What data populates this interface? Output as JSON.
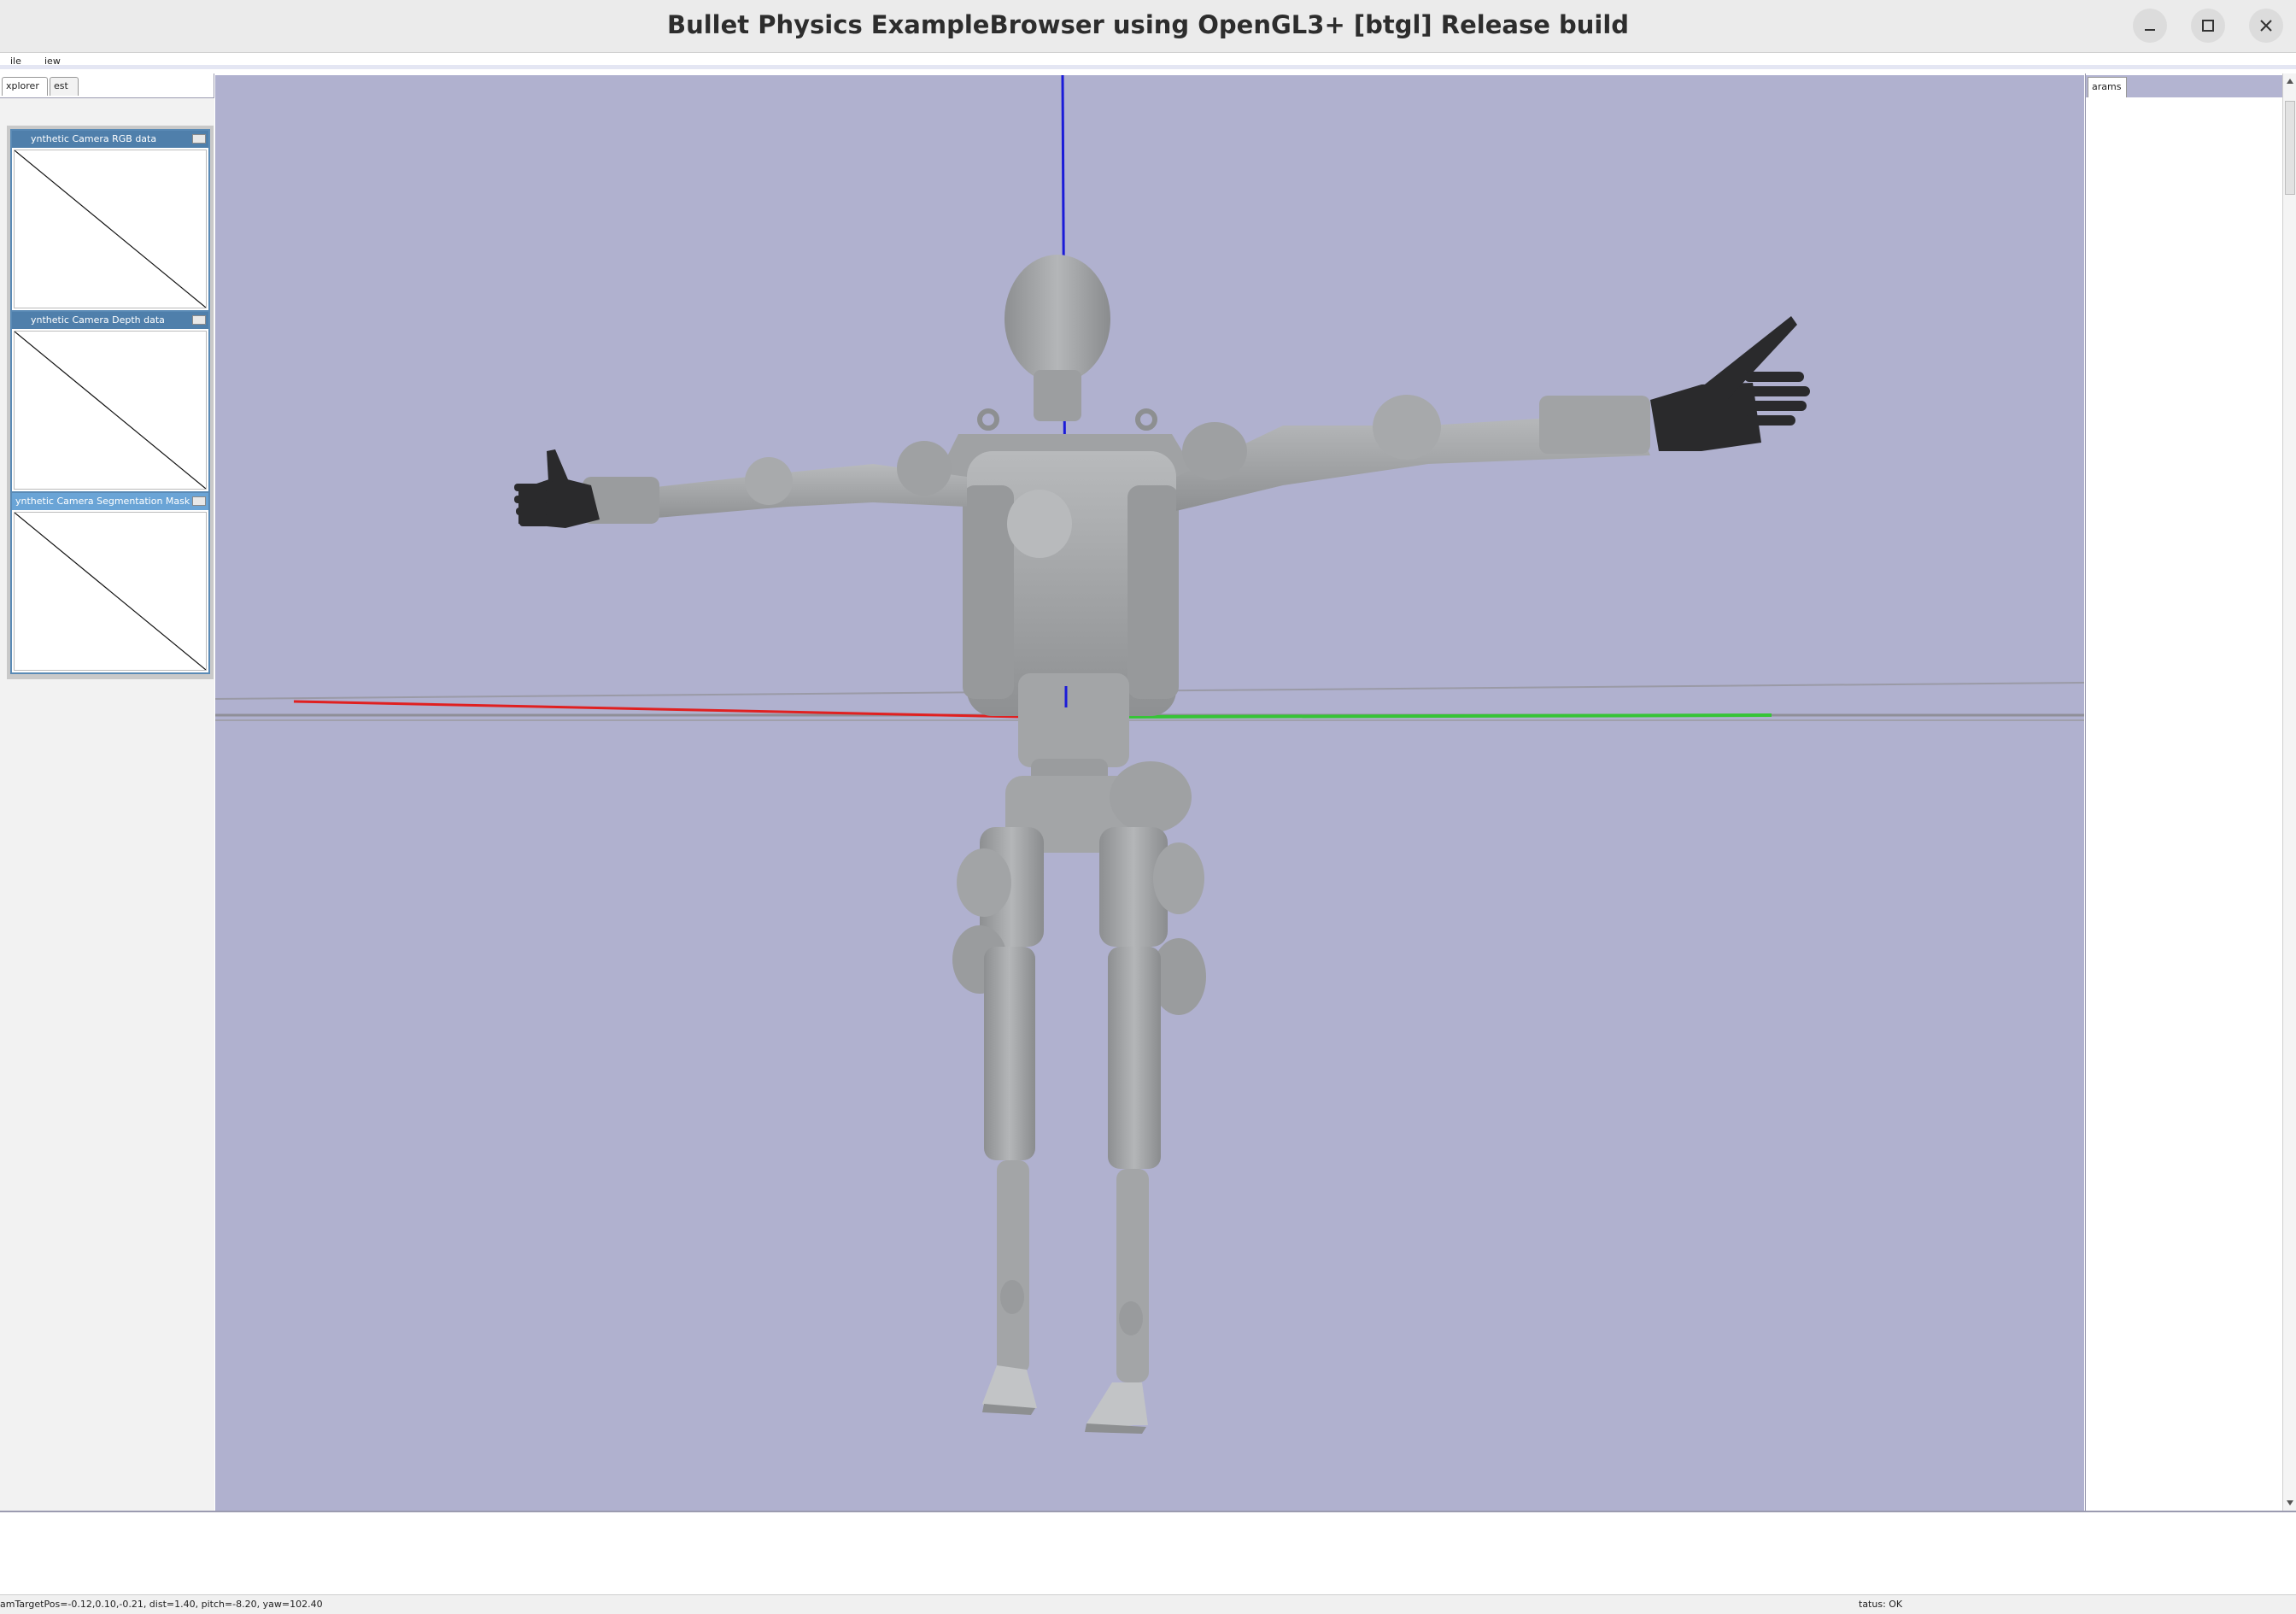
{
  "window": {
    "title": "Bullet Physics ExampleBrowser using OpenGL3+ [btgl] Release build",
    "controls": [
      "minimize-icon",
      "maximize-icon",
      "close-icon"
    ]
  },
  "menubar": {
    "file": "ile",
    "view": "iew"
  },
  "left_panel": {
    "tabs": [
      {
        "label": "xplorer"
      },
      {
        "label": "est"
      }
    ],
    "camera_windows": [
      {
        "title": "ynthetic Camera RGB data"
      },
      {
        "title": "ynthetic Camera Depth data"
      },
      {
        "title": "ynthetic Camera Segmentation Mask"
      }
    ]
  },
  "right_panel": {
    "tab": "arams"
  },
  "viewport": {
    "background": "#b0b1cf",
    "axis_colors": {
      "x": "#e02020",
      "y": "#36c436",
      "z": "#1b1bd8"
    },
    "robot_color": "#a3a5a7",
    "hand_color": "#2a2a2c"
  },
  "status": {
    "camera_info": "amTargetPos=-0.12,0.10,-0.21, dist=1.40, pitch=-8.20, yaw=102.40",
    "status_text": "tatus: OK"
  }
}
